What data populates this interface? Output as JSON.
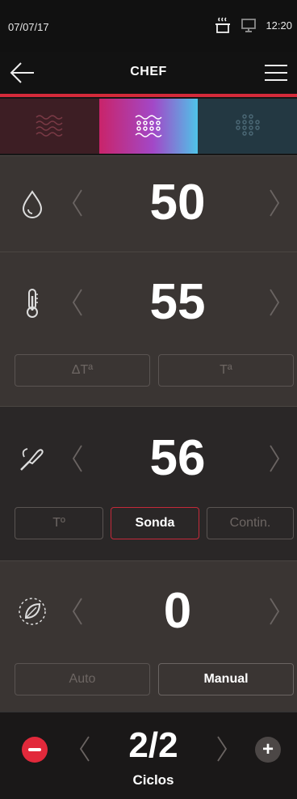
{
  "status_bar": {
    "date": "07/07/17",
    "time": "12:20",
    "icons": [
      "steam-pot-icon",
      "screen-icon"
    ]
  },
  "app_bar": {
    "title": "CHEF",
    "back_icon": "arrow-left-icon",
    "menu_icon": "hamburger-menu-icon"
  },
  "modes": [
    {
      "icon": "steam-waves-icon",
      "active": false
    },
    {
      "icon": "combi-steam-icon",
      "active": true
    },
    {
      "icon": "convection-dots-icon",
      "active": false
    }
  ],
  "humidity": {
    "icon": "drop-icon",
    "value": "50"
  },
  "temperature": {
    "icon": "thermometer-icon",
    "value": "55",
    "options": [
      {
        "label": "ΔTª",
        "active": false
      },
      {
        "label": "Tª",
        "active": false
      }
    ]
  },
  "probe": {
    "icon": "probe-icon",
    "value": "56",
    "options": [
      {
        "label": "Tº",
        "active": false
      },
      {
        "label": "Sonda",
        "active": true
      },
      {
        "label": "Contin.",
        "active": false
      }
    ]
  },
  "eco": {
    "icon": "eco-leaf-icon",
    "value": "0",
    "options": [
      {
        "label": "Auto",
        "active": false
      },
      {
        "label": "Manual",
        "active": true
      }
    ]
  },
  "cycles": {
    "value": "2/2",
    "label": "Ciclos",
    "minus_icon": "minus-icon",
    "plus_label": "+"
  },
  "colors": {
    "accent_red": "#e2293b",
    "background": "#161616"
  }
}
